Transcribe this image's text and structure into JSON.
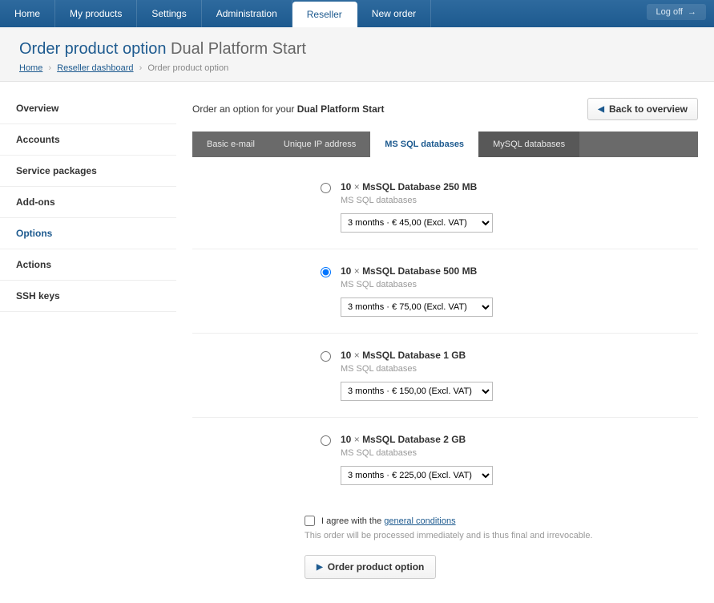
{
  "topnav": {
    "tabs": [
      "Home",
      "My products",
      "Settings",
      "Administration",
      "Reseller",
      "New order"
    ],
    "active_index": 4,
    "logoff": "Log off"
  },
  "header": {
    "title_prefix": "Order product option",
    "title_product": "Dual Platform Start",
    "breadcrumb": {
      "home": "Home",
      "dash": "Reseller dashboard",
      "current": "Order product option"
    }
  },
  "sidebar": {
    "items": [
      "Overview",
      "Accounts",
      "Service packages",
      "Add-ons",
      "Options",
      "Actions",
      "SSH keys"
    ],
    "active_index": 4
  },
  "main": {
    "intro_prefix": "Order an option for your",
    "intro_product": "Dual Platform Start",
    "back_label": "Back to overview",
    "subtabs": [
      "Basic e-mail",
      "Unique IP address",
      "MS SQL databases",
      "MySQL databases"
    ],
    "subtab_active_index": 2,
    "options": [
      {
        "qty": "10",
        "times": "×",
        "name": "MsSQL Database 250 MB",
        "sub": "MS SQL databases",
        "price_label": "3 months · € 45,00 (Excl. VAT)",
        "selected": false
      },
      {
        "qty": "10",
        "times": "×",
        "name": "MsSQL Database 500 MB",
        "sub": "MS SQL databases",
        "price_label": "3 months · € 75,00 (Excl. VAT)",
        "selected": true
      },
      {
        "qty": "10",
        "times": "×",
        "name": "MsSQL Database 1 GB",
        "sub": "MS SQL databases",
        "price_label": "3 months · € 150,00 (Excl. VAT)",
        "selected": false
      },
      {
        "qty": "10",
        "times": "×",
        "name": "MsSQL Database 2 GB",
        "sub": "MS SQL databases",
        "price_label": "3 months · € 225,00 (Excl. VAT)",
        "selected": false
      }
    ],
    "agree_prefix": "I agree with the",
    "agree_link": "general conditions",
    "agree_note": "This order will be processed immediately and is thus final and irrevocable.",
    "order_button": "Order product option"
  }
}
